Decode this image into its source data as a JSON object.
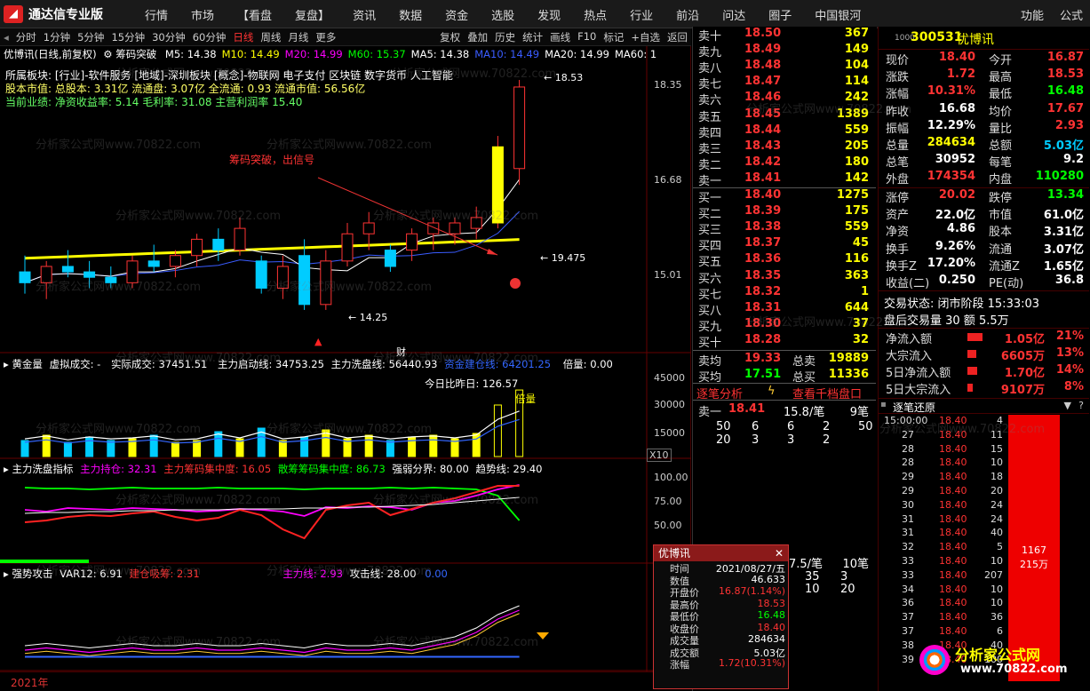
{
  "app": {
    "title": "通达信专业版",
    "menu": [
      "行情",
      "市场",
      "【看盘",
      "复盘】",
      "资讯",
      "数据",
      "资金",
      "选股",
      "发现",
      "热点",
      "行业",
      "前沿",
      "问达",
      "圈子",
      "中国银河"
    ],
    "right_menu": [
      "功能",
      "公式"
    ]
  },
  "toolbar": {
    "periods": [
      "分时",
      "1分钟",
      "5分钟",
      "15分钟",
      "30分钟",
      "60分钟",
      "日线",
      "周线",
      "月线",
      "更多"
    ],
    "active_period": "日线",
    "tools": [
      "复权",
      "叠加",
      "历史",
      "统计",
      "画线",
      "F10",
      "标记",
      "+自选",
      "返回"
    ]
  },
  "chart": {
    "header": "优博讯(日线,前复权)",
    "indicator": "筹码突破",
    "ma": [
      {
        "label": "M5: 14.38",
        "color": "#ffffff"
      },
      {
        "label": "M10: 14.49",
        "color": "#ffff00"
      },
      {
        "label": "M20: 14.99",
        "color": "#ff00ff"
      },
      {
        "label": "M60: 15.37",
        "color": "#00ff00"
      },
      {
        "label": "MA5: 14.38",
        "color": "#ffffff"
      },
      {
        "label": "MA10: 14.49",
        "color": "#3a5cff"
      },
      {
        "label": "MA20: 14.99",
        "color": "#ffffff"
      },
      {
        "label": "MA60: 1",
        "color": "#ffffff"
      }
    ],
    "info_lines": [
      {
        "text": "所属板块: [行业]-软件服务 [地域]-深圳板块 [概念]-物联网 电子支付 区块链 数字货币 人工智能",
        "color": "#ffffff"
      },
      {
        "text": "股本市值: 总股本: 3.31亿 流通盘: 3.07亿 全流通: 0.93 流通市值: 56.56亿",
        "color": "#ffff66"
      },
      {
        "text": "当前业绩: 净资收益率: 5.14 毛利率: 31.08 主营利润率 15.40",
        "color": "#66ff66"
      }
    ],
    "annotation": "筹码突破，出信号",
    "price_labels": {
      "high": "18.53",
      "low": "14.25",
      "trend": "19.475"
    },
    "y_axis": [
      "18.35",
      "16.68",
      "15.01"
    ],
    "fin_tag": "财",
    "candles": [
      {
        "o": 15.0,
        "h": 15.3,
        "l": 14.6,
        "c": 14.8
      },
      {
        "o": 14.8,
        "h": 15.2,
        "l": 14.5,
        "c": 15.1
      },
      {
        "o": 15.1,
        "h": 15.4,
        "l": 14.9,
        "c": 15.0
      },
      {
        "o": 15.0,
        "h": 15.2,
        "l": 14.7,
        "c": 14.9
      },
      {
        "o": 14.9,
        "h": 15.1,
        "l": 14.7,
        "c": 14.8
      },
      {
        "o": 14.8,
        "h": 15.3,
        "l": 14.7,
        "c": 15.2
      },
      {
        "o": 15.2,
        "h": 15.5,
        "l": 15.0,
        "c": 15.1
      },
      {
        "o": 15.1,
        "h": 15.4,
        "l": 14.9,
        "c": 15.3
      },
      {
        "o": 15.3,
        "h": 15.7,
        "l": 15.1,
        "c": 15.6
      },
      {
        "o": 15.6,
        "h": 15.8,
        "l": 15.2,
        "c": 15.4
      },
      {
        "o": 15.4,
        "h": 16.0,
        "l": 15.3,
        "c": 15.8
      },
      {
        "o": 15.2,
        "h": 15.3,
        "l": 14.6,
        "c": 14.7
      },
      {
        "o": 14.7,
        "h": 15.3,
        "l": 14.5,
        "c": 15.1
      },
      {
        "o": 15.3,
        "h": 15.6,
        "l": 14.3,
        "c": 14.4
      },
      {
        "o": 14.4,
        "h": 15.4,
        "l": 14.3,
        "c": 15.2
      },
      {
        "o": 15.2,
        "h": 15.9,
        "l": 15.1,
        "c": 15.7
      },
      {
        "o": 15.7,
        "h": 16.1,
        "l": 15.4,
        "c": 15.9
      },
      {
        "o": 15.4,
        "h": 15.5,
        "l": 15.0,
        "c": 15.1
      },
      {
        "o": 15.4,
        "h": 15.8,
        "l": 15.2,
        "c": 15.7
      },
      {
        "o": 15.7,
        "h": 16.0,
        "l": 15.4,
        "c": 15.9
      },
      {
        "o": 15.7,
        "h": 16.0,
        "l": 15.5,
        "c": 15.9
      },
      {
        "o": 15.8,
        "h": 16.2,
        "l": 15.6,
        "c": 16.0
      },
      {
        "o": 15.9,
        "h": 17.5,
        "l": 15.8,
        "c": 17.3
      },
      {
        "o": 16.9,
        "h": 18.53,
        "l": 16.6,
        "c": 18.4
      }
    ],
    "vol_panel": {
      "name": "黄金量",
      "fields": [
        "虚拟成交: -",
        "实际成交: 37451.51",
        "主力启动线: 34753.25",
        "主力洗盘线: 56440.93",
        "资金建仓线: 64201.25",
        "倍量: 0.00"
      ],
      "ratio_label": "今日比昨日: 126.57",
      "double_label": "倍量",
      "y_axis": [
        "45000",
        "30000",
        "15000"
      ],
      "unit": "X10",
      "values": [
        9000,
        12000,
        8000,
        11000,
        9000,
        10000,
        12000,
        8000,
        9000,
        14000,
        10000,
        16000,
        9000,
        11000,
        15000,
        10000,
        12000,
        9000,
        11000,
        12000,
        10000,
        13000,
        29000,
        37451
      ]
    },
    "wash_panel": {
      "name": "主力洗盘指标",
      "fields": [
        "主力持仓: 32.31",
        "主力筹码集中度: 16.05",
        "散筹筹码集中度: 86.73",
        "强弱分界: 80.00",
        "趋势线: 29.40"
      ],
      "y_axis": [
        "100.00",
        "75.00",
        "50.00"
      ]
    },
    "attack_panel": {
      "name": "强势攻击",
      "fields": [
        "VAR12: 6.91",
        "建仓吸筹: 2.31",
        "主力线: 2.93",
        "攻击线: 28.00",
        "0.00"
      ]
    },
    "year": "2021年"
  },
  "orderbook": {
    "asks": [
      {
        "label": "卖十",
        "price": "18.50",
        "vol": "367"
      },
      {
        "label": "卖九",
        "price": "18.49",
        "vol": "149"
      },
      {
        "label": "卖八",
        "price": "18.48",
        "vol": "104"
      },
      {
        "label": "卖七",
        "price": "18.47",
        "vol": "114"
      },
      {
        "label": "卖六",
        "price": "18.46",
        "vol": "242"
      },
      {
        "label": "卖五",
        "price": "18.45",
        "vol": "1389"
      },
      {
        "label": "卖四",
        "price": "18.44",
        "vol": "559"
      },
      {
        "label": "卖三",
        "price": "18.43",
        "vol": "205"
      },
      {
        "label": "卖二",
        "price": "18.42",
        "vol": "180"
      },
      {
        "label": "卖一",
        "price": "18.41",
        "vol": "142"
      }
    ],
    "bids": [
      {
        "label": "买一",
        "price": "18.40",
        "vol": "1275"
      },
      {
        "label": "买二",
        "price": "18.39",
        "vol": "175"
      },
      {
        "label": "买三",
        "price": "18.38",
        "vol": "559"
      },
      {
        "label": "买四",
        "price": "18.37",
        "vol": "45"
      },
      {
        "label": "买五",
        "price": "18.36",
        "vol": "116"
      },
      {
        "label": "买六",
        "price": "18.35",
        "vol": "363"
      },
      {
        "label": "买七",
        "price": "18.32",
        "vol": "1"
      },
      {
        "label": "买八",
        "price": "18.31",
        "vol": "644"
      },
      {
        "label": "买九",
        "price": "18.30",
        "vol": "37"
      },
      {
        "label": "买十",
        "price": "18.28",
        "vol": "32"
      }
    ],
    "avg_sell": {
      "label": "卖均",
      "price": "19.33",
      "label2": "总卖",
      "vol": "19889"
    },
    "avg_buy": {
      "label": "买均",
      "price": "17.51",
      "label2": "总买",
      "vol": "11336"
    },
    "tab_detail": "逐笔分析",
    "tab_thousand": "查看千档盘口",
    "detail_row": {
      "label": "卖一",
      "price": "18.41",
      "rate": "15.8/笔",
      "count": "9笔"
    },
    "detail_grid": [
      [
        "50",
        "6",
        "6",
        "2",
        "50"
      ],
      [
        "20",
        "3",
        "3",
        "2",
        ""
      ]
    ],
    "detail2_row": {
      "rate": "7.5/笔",
      "count": "10笔"
    },
    "detail2_grid": [
      [
        "2",
        "35",
        "3"
      ],
      [
        "1",
        "10",
        "20"
      ]
    ]
  },
  "quote": {
    "code": "300531",
    "name": "优博讯",
    "rows": [
      {
        "l1": "现价",
        "v1": "18.40",
        "c1": "red",
        "l2": "今开",
        "v2": "16.87",
        "c2": "red"
      },
      {
        "l1": "涨跌",
        "v1": "1.72",
        "c1": "red",
        "l2": "最高",
        "v2": "18.53",
        "c2": "red"
      },
      {
        "l1": "涨幅",
        "v1": "10.31%",
        "c1": "red",
        "l2": "最低",
        "v2": "16.48",
        "c2": "green"
      },
      {
        "l1": "昨收",
        "v1": "16.68",
        "c1": "white",
        "l2": "均价",
        "v2": "17.67",
        "c2": "red"
      },
      {
        "l1": "振幅",
        "v1": "12.29%",
        "c1": "white",
        "l2": "量比",
        "v2": "2.93",
        "c2": "red"
      },
      {
        "l1": "总量",
        "v1": "284634",
        "c1": "yellow",
        "l2": "总额",
        "v2": "5.03亿",
        "c2": "cyan"
      },
      {
        "l1": "总笔",
        "v1": "30952",
        "c1": "white",
        "l2": "每笔",
        "v2": "9.2",
        "c2": "white"
      },
      {
        "l1": "外盘",
        "v1": "174354",
        "c1": "red",
        "l2": "内盘",
        "v2": "110280",
        "c2": "green"
      }
    ],
    "rows2": [
      {
        "l1": "涨停",
        "v1": "20.02",
        "c1": "red",
        "l2": "跌停",
        "v2": "13.34",
        "c2": "green"
      },
      {
        "l1": "资产",
        "v1": "22.0亿",
        "c1": "white",
        "l2": "市值",
        "v2": "61.0亿",
        "c2": "white"
      },
      {
        "l1": "净资",
        "v1": "4.86",
        "c1": "white",
        "l2": "股本",
        "v2": "3.31亿",
        "c2": "white"
      },
      {
        "l1": "换手",
        "v1": "9.26%",
        "c1": "white",
        "l2": "流通",
        "v2": "3.07亿",
        "c2": "white"
      },
      {
        "l1": "换手Z",
        "v1": "17.20%",
        "c1": "white",
        "l2": "流通Z",
        "v2": "1.65亿",
        "c2": "white"
      },
      {
        "l1": "收益(二)",
        "v1": "0.250",
        "c1": "white",
        "l2": "PE(动)",
        "v2": "36.8",
        "c2": "white"
      }
    ],
    "trade_status": "交易状态: 闭市阶段  15:33:03",
    "after_hours": "盘后交易量 30 额 5.5万",
    "flows": [
      {
        "label": "净流入额",
        "value": "1.05亿",
        "pct": "21%",
        "bar": 0.21
      },
      {
        "label": "大宗流入",
        "value": "6605万",
        "pct": "13%",
        "bar": 0.13
      },
      {
        "label": "5日净流入额",
        "value": "1.70亿",
        "pct": "14%",
        "bar": 0.14
      },
      {
        "label": "5日大宗流入",
        "value": "9107万",
        "pct": "8%",
        "bar": 0.08
      }
    ],
    "trades_title": "逐笔还原",
    "trades": [
      {
        "t": "15:00:00",
        "p": "18.40",
        "n": "4"
      },
      {
        "t": "27",
        "p": "18.40",
        "n": "11"
      },
      {
        "t": "28",
        "p": "18.40",
        "n": "15"
      },
      {
        "t": "28",
        "p": "18.40",
        "n": "10"
      },
      {
        "t": "29",
        "p": "18.40",
        "n": "18"
      },
      {
        "t": "29",
        "p": "18.40",
        "n": "20"
      },
      {
        "t": "30",
        "p": "18.40",
        "n": "24"
      },
      {
        "t": "31",
        "p": "18.40",
        "n": "24"
      },
      {
        "t": "31",
        "p": "18.40",
        "n": "40"
      },
      {
        "t": "32",
        "p": "18.40",
        "n": "5"
      },
      {
        "t": "33",
        "p": "18.40",
        "n": "10"
      },
      {
        "t": "33",
        "p": "18.40",
        "n": "207"
      },
      {
        "t": "34",
        "p": "18.40",
        "n": "10"
      },
      {
        "t": "36",
        "p": "18.40",
        "n": "10"
      },
      {
        "t": "37",
        "p": "18.40",
        "n": "36"
      },
      {
        "t": "37",
        "p": "18.40",
        "n": "6"
      },
      {
        "t": "38",
        "p": "18.40",
        "n": "40"
      },
      {
        "t": "39",
        "p": "18.40",
        "n": "100"
      }
    ],
    "big_order": {
      "count": "1167",
      "amount": "215万"
    }
  },
  "popup": {
    "title": "优博讯",
    "rows": [
      {
        "k": "时间",
        "v": "2021/08/27/五",
        "c": "white"
      },
      {
        "k": "数值",
        "v": "46.633",
        "c": "white"
      },
      {
        "k": "开盘价",
        "v": "16.87(1.14%)",
        "c": "red"
      },
      {
        "k": "最高价",
        "v": "18.53",
        "c": "red"
      },
      {
        "k": "最低价",
        "v": "16.48",
        "c": "green"
      },
      {
        "k": "收盘价",
        "v": "18.40",
        "c": "red"
      },
      {
        "k": "成交量",
        "v": "284634",
        "c": "white"
      },
      {
        "k": "成交额",
        "v": "5.03亿",
        "c": "white"
      },
      {
        "k": "涨幅",
        "v": "1.72(10.31%)",
        "c": "red"
      }
    ]
  },
  "watermark": "分析家公式网www.70822.com",
  "brand": {
    "name": "分析家公式网",
    "url": "www.70822.com"
  }
}
